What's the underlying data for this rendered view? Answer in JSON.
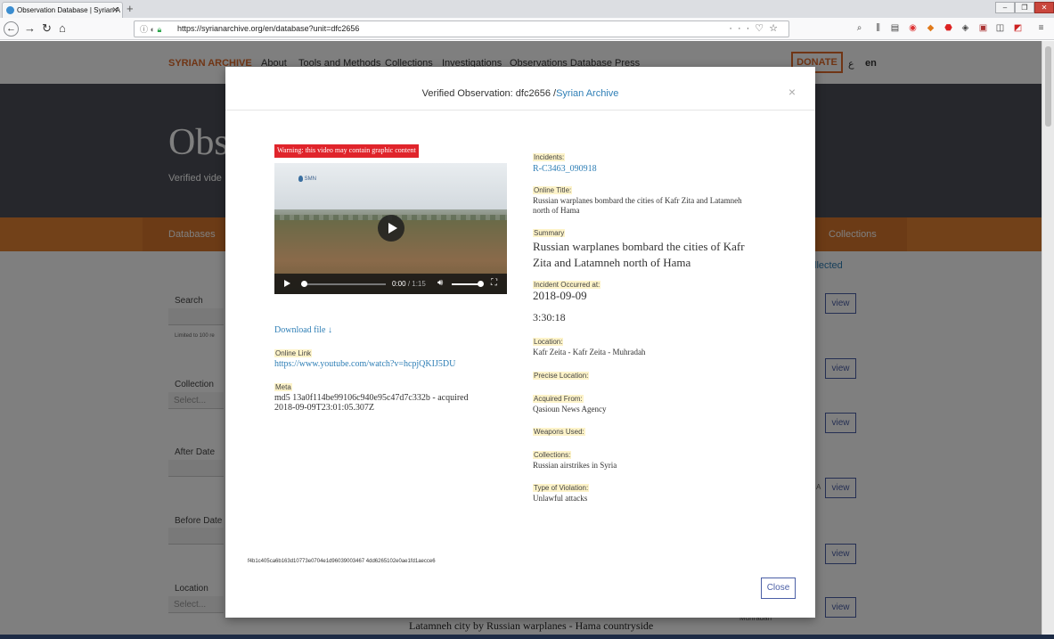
{
  "browser": {
    "tab_title": "Observation Database | Syrian A",
    "url": "https://syrianarchive.org/en/database?unit=dfc2656"
  },
  "site": {
    "logo": "SYRIAN ARCHIVE",
    "nav": [
      "About",
      "Tools and Methods",
      "Collections",
      "Investigations",
      "Observations Database",
      "Press"
    ],
    "donate": "DONATE",
    "lang_ar": "ع",
    "lang_en": "en",
    "hero_title": "Obs",
    "hero_sub": "Verified vide",
    "bar_left": "Databases",
    "bar_right": "Collections",
    "collected": "llected",
    "filters": {
      "search_label": "Search",
      "search_hint": "Limited to 100 re",
      "collection_label": "Collection",
      "collection_placeholder": "Select...",
      "after_label": "After Date",
      "before_label": "Before Date",
      "location_label": "Location",
      "location_placeholder": "Select..."
    },
    "view_label": "view",
    "side_snippets": [
      "A",
      "Muhradah"
    ],
    "bottom_text": "Latamneh city by Russian warplanes - Hama countryside"
  },
  "modal": {
    "title_prefix": "Verified Observation: dfc2656 /",
    "title_link": "Syrian Archive",
    "close_x": "×",
    "warning": "Warning: this video may contain graphic content",
    "video": {
      "watermark": "SMN",
      "current_time": "0:00",
      "duration": "/ 1:15",
      "progress": 0
    },
    "download": "Download file ↓",
    "online_link_label": "Online Link",
    "online_link": "https://www.youtube.com/watch?v=hcpjQKIJ5DU",
    "meta_label": "Meta",
    "meta_value": "md5 13a0f114be99106c940e95c47d7c332b - acquired 2018-09-09T23:01:05.307Z",
    "fields": {
      "incidents_label": "Incidents:",
      "incidents_value": "R-C3463_090918",
      "online_title_label": "Online Title:",
      "online_title_value": "Russian warplanes bombard the cities of Kafr Zita and Latamneh north of Hama",
      "summary_label": "Summary",
      "summary_value": "Russian warplanes bombard the cities of Kafr Zita and Latamneh north of Hama",
      "occurred_label": "Incident Occurred at:",
      "occurred_date": "2018-09-09",
      "occurred_time": "3:30:18",
      "location_label": "Location:",
      "location_value": "Kafr Zeita - Kafr Zeita - Muhradah",
      "precise_label": "Precise Location:",
      "acquired_label": "Acquired From:",
      "acquired_value": "Qasioun News Agency",
      "weapons_label": "Weapons Used:",
      "collections_label": "Collections:",
      "collections_value": "Russian airstrikes in Syria",
      "violation_label": "Type of Violation:",
      "violation_value": "Unlawful attacks"
    },
    "hash": "f4b1c405ca6b163d10773e0704e1d96039003467 4dd6265102e0ae1fd1aecce6",
    "close_button": "Close"
  }
}
